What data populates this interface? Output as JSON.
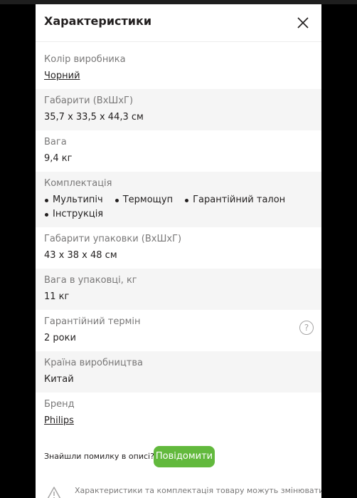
{
  "modal": {
    "title": "Характеристики",
    "close_icon": "close-icon"
  },
  "specs": [
    {
      "label": "Колір виробника",
      "value": "Чорний",
      "link": true
    },
    {
      "label": "Габарити (ВхШхГ)",
      "value": "35,7 x 33,5 x 44,3 см"
    },
    {
      "label": "Вага",
      "value": "9,4 кг"
    },
    {
      "label": "Комплектація",
      "items": [
        "Мультипіч",
        "Термощуп",
        "Гарантійний талон",
        "Інструкція"
      ]
    },
    {
      "label": "Габарити упаковки (ВхШхГ)",
      "value": "43 x 38 x 48 см"
    },
    {
      "label": "Вага в упаковці, кг",
      "value": "11 кг"
    },
    {
      "label": "Гарантійний термін",
      "value": "2 роки",
      "help_icon": "question-circle-icon"
    },
    {
      "label": "Країна виробництва",
      "value": "Китай"
    },
    {
      "label": "Бренд",
      "value": "Philips",
      "link": true
    }
  ],
  "report": {
    "text": "Знайшли помилку в описі?",
    "button": "Повідомити"
  },
  "note": {
    "icon": "warning-icon",
    "text": "Характеристики та комплектація товару можуть змінюватися"
  },
  "colors": {
    "accent_green": "#62b93d",
    "alt_row": "#f5f5f5",
    "label_gray": "#797878",
    "text": "#221f1f"
  }
}
